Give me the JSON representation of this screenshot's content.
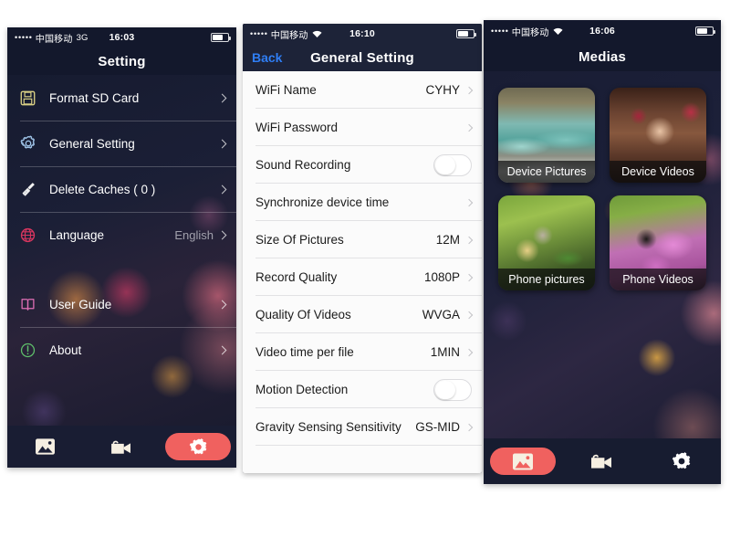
{
  "panel_setting": {
    "status": {
      "carrier": "中国移动",
      "network": "3G",
      "time": "16:03",
      "signal_dots": "•••••"
    },
    "nav_title": "Setting",
    "rows": [
      {
        "icon": "floppy-disk-icon",
        "label": "Format SD Card",
        "value": ""
      },
      {
        "icon": "gear-icon",
        "label": "General Setting",
        "value": ""
      },
      {
        "icon": "broom-icon",
        "label": "Delete Caches ( 0 )",
        "value": ""
      },
      {
        "icon": "globe-icon",
        "label": "Language",
        "value": "English"
      },
      {
        "icon": "book-icon",
        "label": "User Guide",
        "value": ""
      },
      {
        "icon": "info-icon",
        "label": "About",
        "value": ""
      }
    ],
    "tabs": [
      {
        "icon": "photos-icon",
        "active": false
      },
      {
        "icon": "video-camera-icon",
        "active": false
      },
      {
        "icon": "gear-icon",
        "active": true
      }
    ]
  },
  "panel_general": {
    "status": {
      "carrier": "中国移动",
      "network": "wifi",
      "time": "16:10",
      "signal_dots": "•••••"
    },
    "nav_title": "General Setting",
    "back_label": "Back",
    "rows": [
      {
        "label": "WiFi Name",
        "value": "CYHY",
        "type": "chevron"
      },
      {
        "label": "WiFi Password",
        "value": "",
        "type": "chevron"
      },
      {
        "label": "Sound Recording",
        "value": "",
        "type": "toggle"
      },
      {
        "label": "Synchronize device time",
        "value": "",
        "type": "chevron"
      },
      {
        "label": "Size Of Pictures",
        "value": "12M",
        "type": "chevron"
      },
      {
        "label": "Record Quality",
        "value": "1080P",
        "type": "chevron"
      },
      {
        "label": "Quality Of Videos",
        "value": "WVGA",
        "type": "chevron"
      },
      {
        "label": "Video time per file",
        "value": "1MIN",
        "type": "chevron"
      },
      {
        "label": "Motion Detection",
        "value": "",
        "type": "toggle"
      },
      {
        "label": "Gravity Sensing Sensitivity",
        "value": "GS-MID",
        "type": "chevron"
      }
    ]
  },
  "panel_medias": {
    "status": {
      "carrier": "中国移动",
      "network": "wifi",
      "time": "16:06",
      "signal_dots": "•••••"
    },
    "nav_title": "Medias",
    "tiles": [
      {
        "label": "Device Pictures",
        "art": "art-waterfall"
      },
      {
        "label": "Device Videos",
        "art": "art-girl"
      },
      {
        "label": "Phone pictures",
        "art": "art-bird"
      },
      {
        "label": "Phone Videos",
        "art": "art-bee"
      }
    ],
    "tabs": [
      {
        "icon": "photos-icon",
        "active": true
      },
      {
        "icon": "video-camera-icon",
        "active": false
      },
      {
        "icon": "gear-icon",
        "active": false
      }
    ]
  },
  "colors": {
    "accent": "#f0615f",
    "dark_navy": "#13182c",
    "nav_dark": "#1d2338",
    "back_blue": "#2f7ef5",
    "icon_floppy": "#d8cf84",
    "icon_gear": "#9fc4e8",
    "icon_broom": "#f2f2f2",
    "icon_globe": "#d8365f",
    "icon_book": "#e06fb5",
    "icon_info": "#5fbf6b"
  }
}
